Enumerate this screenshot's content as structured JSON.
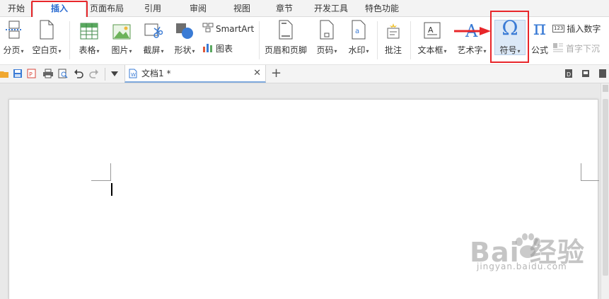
{
  "tabs": [
    {
      "label": "开始",
      "active": false
    },
    {
      "label": "插入",
      "active": true
    },
    {
      "label": "页面布局",
      "active": false
    },
    {
      "label": "引用",
      "active": false
    },
    {
      "label": "审阅",
      "active": false
    },
    {
      "label": "视图",
      "active": false
    },
    {
      "label": "章节",
      "active": false
    },
    {
      "label": "开发工具",
      "active": false
    },
    {
      "label": "特色功能",
      "active": false
    }
  ],
  "ribbon": {
    "page_break": "分页",
    "blank_page": "空白页",
    "table": "表格",
    "picture": "图片",
    "screenshot": "截屏",
    "shape": "形状",
    "smartart": "SmartArt",
    "chart": "图表",
    "header_footer": "页眉和页脚",
    "page_number": "页码",
    "watermark": "水印",
    "comment": "批注",
    "textbox": "文本框",
    "wordart": "艺术字",
    "symbol": "符号",
    "symbol_glyph": "Ω",
    "formula": "公式",
    "formula_glyph": "π",
    "insert_number": "插入数字",
    "insert_number_icon_text": "123",
    "drop_cap": "首字下沉"
  },
  "document_tab": {
    "title": "文档1 *"
  },
  "watermark": {
    "logo": "Bai  经验",
    "url": "jingyan.baidu.com"
  },
  "colors": {
    "accent": "#2a6bd1",
    "highlight_box": "#e8262a",
    "selected_button_bg": "#dce9f7"
  }
}
